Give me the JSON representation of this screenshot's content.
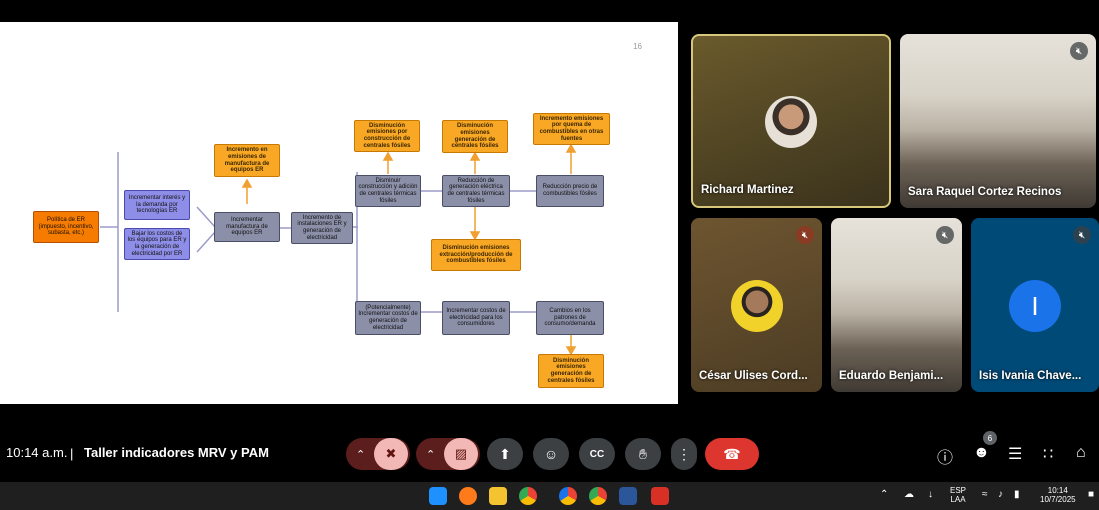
{
  "slide": {
    "page_number": "16",
    "boxes": {
      "politica": "Política de ER (impuesto, incentivo, subasta, etc.)",
      "incrementar_interes": "Incrementar interés y la demanda por tecnologías ER",
      "bajar_costos": "Bajar los costos de los equipos para ER y la generación de electricidad por ER",
      "incremento_emisiones_manufactura": "Incremento en emisiones de manufactura de equipos ER",
      "incrementar_manufactura": "Incrementar manufactura de equipos ER",
      "incremento_instalaciones": "Incremento de instalaciones ER y generación de electricidad",
      "disminucion_emisiones_construccion": "Disminución emisiones por construcción de centrales fósiles",
      "disminuir_construccion": "Disminuir construcción y adición de centrales térmicas fósiles",
      "disminucion_emisiones_generacion_top": "Disminución emisiones generación de centrales fósiles",
      "reduccion_generacion": "Reducción de generación eléctrica de centrales térmicas fósiles",
      "incremento_emisiones_quema": "Incremento emisiones por quema de combustibles en otras fuentes",
      "reduccion_precio": "Reducción precio de combustibles fósiles",
      "disminucion_emisiones_extraccion": "Disminución emisiones extracción/producción de combustibles fósiles",
      "potencialmente": "(Potencialmente) Incrementar costos de generación de electricidad",
      "incrementar_costos_consumidores": "Incrementar costos de electricidad para los consumidores",
      "cambios_patrones": "Cambios en los patrones de consumo/demanda",
      "disminucion_emisiones_generacion_bottom": "Disminución emisiones generación de centrales fósiles"
    }
  },
  "participants": [
    {
      "name": "Richard Martinez",
      "muted": false,
      "speaking": true
    },
    {
      "name": "Sara Raquel Cortez Recinos",
      "muted": true,
      "speaking": false
    },
    {
      "name": "César Ulises Cord...",
      "muted": true,
      "speaking": false
    },
    {
      "name": "Eduardo Benjami...",
      "muted": true,
      "speaking": false
    },
    {
      "name": "Isis Ivania Chave...",
      "muted": true,
      "speaking": false,
      "initial": "I"
    }
  ],
  "meetbar": {
    "time": "10:14 a.m.",
    "separator": "|",
    "title": "Taller indicadores MRV y PAM",
    "people_count": "6"
  },
  "taskbar": {
    "lang_top": "ESP",
    "lang_bottom": "LAA",
    "time": "10:14",
    "date": "10/7/2025"
  },
  "colors": {
    "end_call": "#dc362e",
    "speaking_border": "#d6c77a",
    "avatar_blue": "#1a73e8"
  }
}
